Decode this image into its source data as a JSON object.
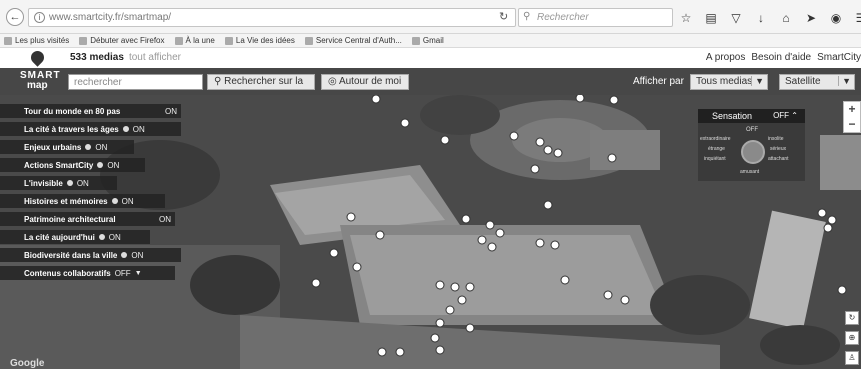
{
  "browser": {
    "url": "www.smartcity.fr/smartmap/",
    "search_placeholder": "Rechercher",
    "bookmarks": [
      "Les plus visités",
      "Débuter avec Firefox",
      "À la une",
      "La Vie des idées",
      "Service Central d'Auth...",
      "Gmail"
    ]
  },
  "site": {
    "media_count": "533 medias",
    "show_all": "tout afficher",
    "links": [
      "A propos",
      "Besoin d'aide",
      "SmartCity"
    ]
  },
  "toolbar": {
    "logo_line1": "SMART",
    "logo_line2": "map",
    "search_placeholder": "rechercher",
    "search_button": "Rechercher sur la",
    "around_button": "Autour de moi",
    "display_label": "Afficher par",
    "media_select": "Tous medias",
    "map_select": "Satellite"
  },
  "layers": [
    {
      "label": "Tour du monde en 80 pas",
      "state": "ON"
    },
    {
      "label": "La cité à travers les âges",
      "state": "ON"
    },
    {
      "label": "Enjeux urbains",
      "state": "ON"
    },
    {
      "label": "Actions SmartCity",
      "state": "ON"
    },
    {
      "label": "L'invisible",
      "state": "ON"
    },
    {
      "label": "Histoires et mémoires",
      "state": "ON"
    },
    {
      "label": "Patrimoine architectural",
      "state": "ON"
    },
    {
      "label": "La cité aujourd'hui",
      "state": "ON"
    },
    {
      "label": "Biodiversité dans la ville",
      "state": "ON"
    },
    {
      "label": "Contenus collaboratifs",
      "state": "OFF"
    }
  ],
  "sensation": {
    "title": "Sensation",
    "state": "OFF",
    "wheel": {
      "top": "OFF",
      "left_top": "extraordinaire",
      "right_top": "insolite",
      "left_mid": "étrange",
      "right_mid": "sérieux",
      "left_bot": "inquiétant",
      "right_bot": "attachant",
      "bottom": "amusant"
    }
  },
  "map": {
    "attribution": "Google"
  }
}
